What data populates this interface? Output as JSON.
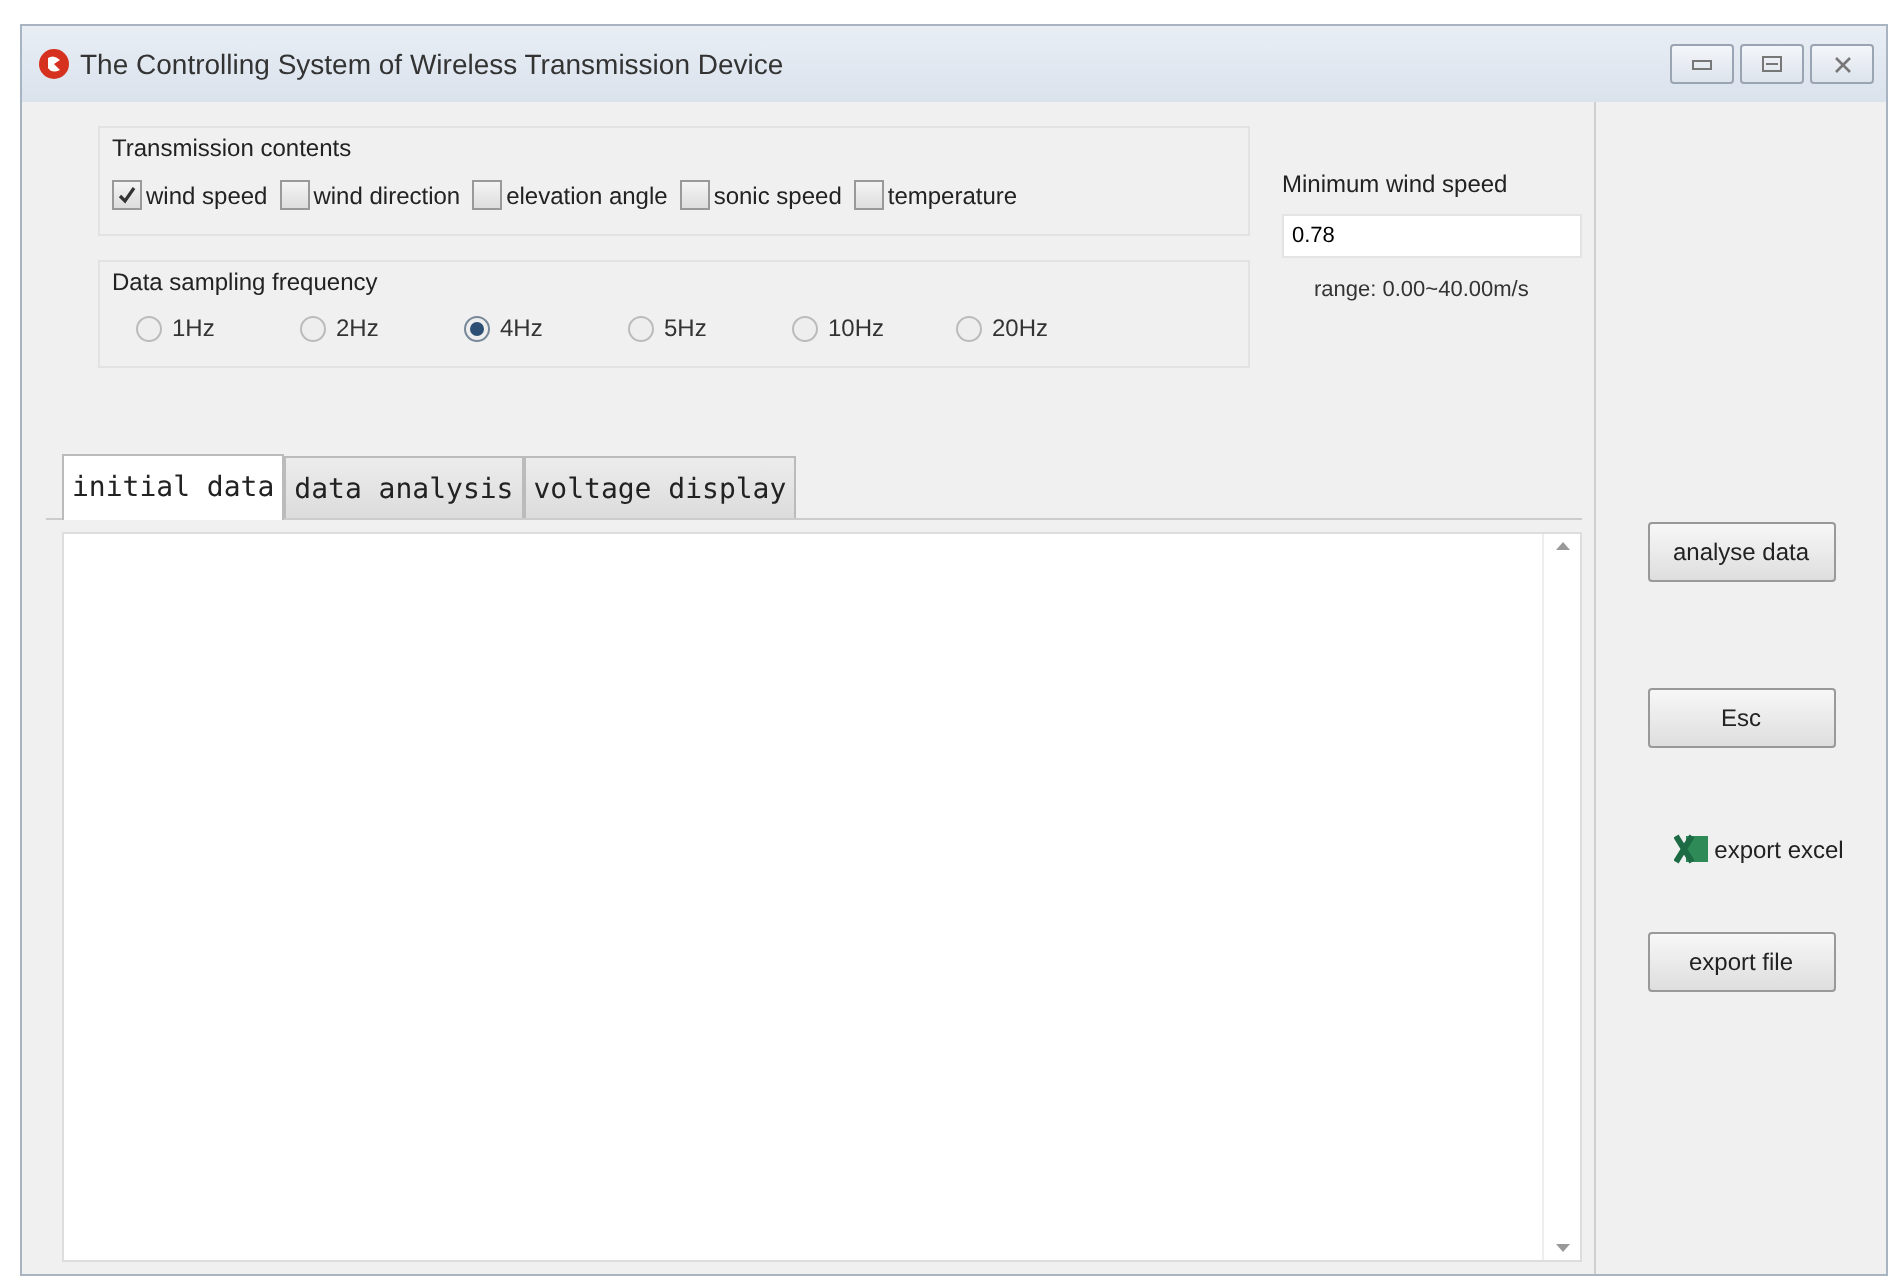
{
  "window": {
    "title": "The Controlling System of Wireless Transmission Device"
  },
  "transmission_contents": {
    "label": "Transmission contents",
    "items": [
      {
        "label": "wind speed",
        "checked": true
      },
      {
        "label": "wind direction",
        "checked": false
      },
      {
        "label": "elevation angle",
        "checked": false
      },
      {
        "label": "sonic speed",
        "checked": false
      },
      {
        "label": "temperature",
        "checked": false
      }
    ]
  },
  "sampling_frequency": {
    "label": "Data sampling frequency",
    "options": [
      {
        "label": "1Hz",
        "selected": false
      },
      {
        "label": "2Hz",
        "selected": false
      },
      {
        "label": "4Hz",
        "selected": true
      },
      {
        "label": "5Hz",
        "selected": false
      },
      {
        "label": "10Hz",
        "selected": false
      },
      {
        "label": "20Hz",
        "selected": false
      }
    ]
  },
  "minimum_wind_speed": {
    "label": "Minimum wind speed",
    "value": "0.78",
    "range": "range: 0.00~40.00m/s"
  },
  "tabs": [
    {
      "label": "initial data",
      "selected": true
    },
    {
      "label": "data analysis",
      "selected": false
    },
    {
      "label": "voltage display",
      "selected": false
    }
  ],
  "actions": [
    {
      "kind": "button",
      "label": "analyse data"
    },
    {
      "kind": "button",
      "label": "Esc"
    },
    {
      "kind": "link",
      "label": "export excel"
    },
    {
      "kind": "button",
      "label": "export file"
    }
  ]
}
